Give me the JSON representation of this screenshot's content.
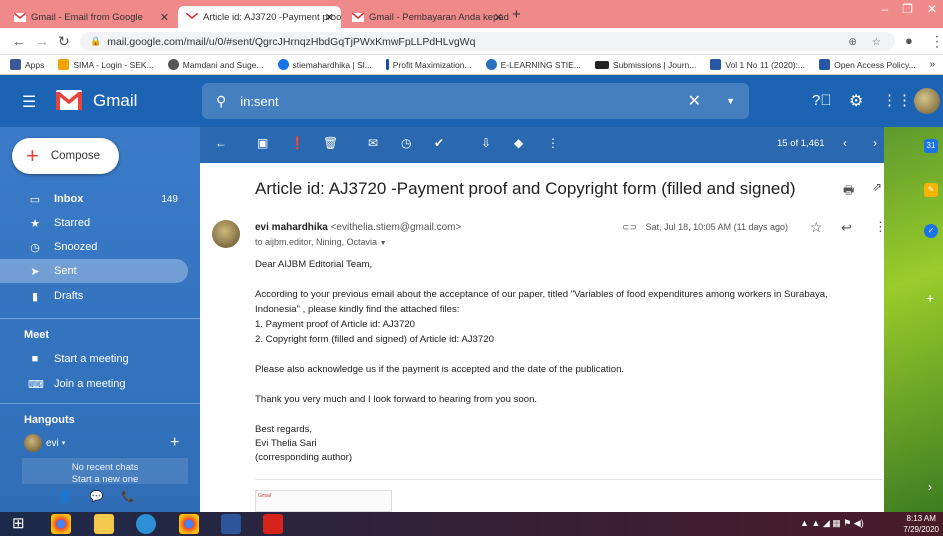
{
  "browser": {
    "tabs": [
      {
        "label": "Gmail - Email from Google",
        "active": false
      },
      {
        "label": "Article id: AJ3720 -Payment proo",
        "active": true
      },
      {
        "label": "Gmail - Pembayaran Anda kepad",
        "active": false
      }
    ],
    "new_tab": "+",
    "url": "mail.google.com/mail/u/0/#sent/QgrcJHrnqzHbdGqTjPWxKmwFpLLPdHLvgWq",
    "bookmarks": [
      {
        "label": "Apps",
        "color": "#e5a01c"
      },
      {
        "label": "SIMA - Login - SEK...",
        "color": "#f0a400"
      },
      {
        "label": "Mamdani and Suge...",
        "color": "#444444"
      },
      {
        "label": "stiemahardhika | Sl...",
        "color": "#1a73e8"
      },
      {
        "label": "Profit Maximization...",
        "color": "#1a4fa0"
      },
      {
        "label": "E-LEARNING STIE...",
        "color": "#2a6fc0"
      },
      {
        "label": "Submissions | Journ...",
        "color": "#222222"
      },
      {
        "label": "Vol 1 No 11 (2020):...",
        "color": "#2457a5"
      },
      {
        "label": "Open Access Policy...",
        "color": "#2457a5"
      }
    ]
  },
  "gmail": {
    "title": "Gmail",
    "search_value": "in:sent",
    "compose_label": "Compose",
    "nav": [
      {
        "label": "Inbox",
        "count": "149",
        "icon": "inbox-icon",
        "selected": false
      },
      {
        "label": "Starred",
        "count": "",
        "icon": "star-icon",
        "selected": false
      },
      {
        "label": "Snoozed",
        "count": "",
        "icon": "clock-icon",
        "selected": false
      },
      {
        "label": "Sent",
        "count": "",
        "icon": "send-icon",
        "selected": true
      },
      {
        "label": "Drafts",
        "count": "",
        "icon": "draft-icon",
        "selected": false
      }
    ],
    "meet_title": "Meet",
    "meet_items": [
      {
        "label": "Start a meeting",
        "icon": "video-icon"
      },
      {
        "label": "Join a meeting",
        "icon": "keyboard-icon"
      }
    ],
    "hangouts_title": "Hangouts",
    "hangouts_user": "evi",
    "no_chats": "No recent chats",
    "start_new": "Start a new one",
    "pager": "15 of 1,461"
  },
  "message": {
    "subject": "Article id: AJ3720 -Payment proof and Copyright form (filled and signed)",
    "sender_name": "evi mahardhika",
    "sender_email": "<evithelia.stiem@gmail.com>",
    "recipients": "to aijbm.editor, Nining, Octavia",
    "date": "Sat, Jul 18, 10:05 AM (11 days ago)",
    "body": [
      "Dear AIJBM Editorial Team,",
      "According to your previous email about the acceptance of our paper, titled \"Variables of food expenditures among workers in Surabaya,",
      "Indonesia\" , please kindly find the attached files:",
      "1. Payment proof of Article id: AJ3720",
      "2. Copyright form (filled and signed) of  Article id: AJ3720",
      "Please also acknowledge us if the payment is accepted and the date of the publication.",
      "Thank you very much and I look forward to hearing from you soon.",
      "Best regards,",
      "Evi Thelia Sari",
      "(corresponding author)"
    ],
    "attachment_brand": "Gmail"
  },
  "taskbar": {
    "time": "8:13 AM",
    "date": "7/29/2020"
  },
  "colors": {
    "tabstrip": "#f08a8a",
    "gmail_header": "#1c63b3",
    "sidebar": "#3a7bc8",
    "accent_red": "#e9443a"
  }
}
